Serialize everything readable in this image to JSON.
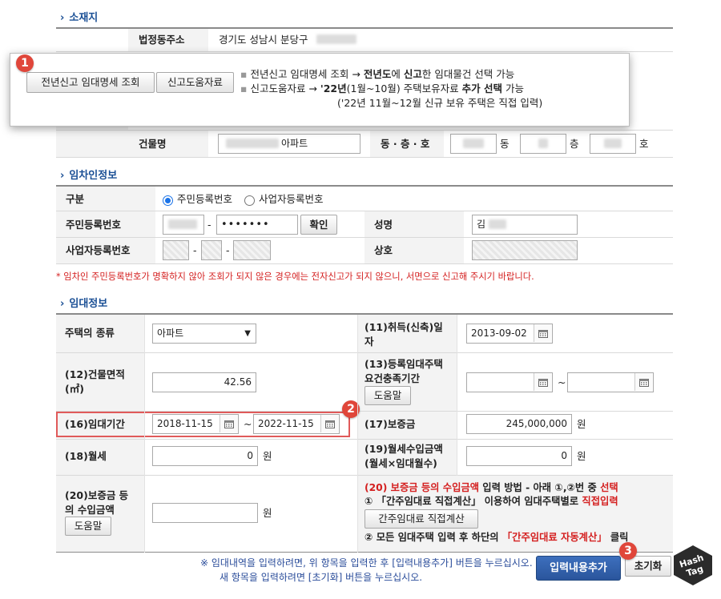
{
  "location": {
    "section_title": "소재지",
    "legal_dong_label": "법정동주소",
    "legal_dong_value": "경기도 성남시 분당구",
    "building_name_label": "건물명",
    "building_name_value": "아파트",
    "dong_cheung_ho_label": "동 · 층 · 호",
    "dong_unit": "동",
    "cheung_unit": "층",
    "ho_unit": "호"
  },
  "popup": {
    "btn_prev_lookup": "전년신고 임대명세 조회",
    "btn_help_data": "신고도움자료",
    "line1_a": "전년신고 임대명세 조회 → ",
    "line1_b": "전년도",
    "line1_c": "에 ",
    "line1_d": "신고",
    "line1_e": "한 임대물건 선택 가능",
    "line2_a": "신고도움자료 → ",
    "line2_b": "'22년",
    "line2_c": "(1월~10월) 주택보유자료 ",
    "line2_d": "추가 선택",
    "line2_e": " 가능",
    "line3": "('22년 11월~12월 신규 보유 주택은 직접 입력)"
  },
  "tenant": {
    "section_title": "임차인정보",
    "type_label": "구분",
    "radio_resident": "주민등록번호",
    "radio_business": "사업자등록번호",
    "resident_no_label": "주민등록번호",
    "resident_no_masked": "•••••••",
    "confirm_button": "확인",
    "name_label": "성명",
    "name_value": "김",
    "business_no_label": "사업자등록번호",
    "trade_name_label": "상호",
    "notice": "* 임차인 주민등록번호가 명확하지 않아 조회가 되지 않은 경우에는 전자신고가 되지 않으니, 서면으로 신고해 주시기 바랍니다."
  },
  "lease": {
    "section_title": "임대정보",
    "house_type_label": "주택의 종류",
    "house_type_value": "아파트",
    "acq_date_label_1": "(11)취득(신축)일",
    "acq_date_label_2": "자",
    "acq_date_value": "2013-09-02",
    "area_label_1": "(12)건물면적",
    "area_label_2": "(㎡)",
    "area_value": "42.56",
    "reg_period_label_1": "(13)등록임대주택",
    "reg_period_label_2": "요건충족기간",
    "help_button": "도움말",
    "period_label": "(16)임대기간",
    "period_start": "2018-11-15",
    "period_end": "2022-11-15",
    "tilde": "~",
    "deposit_label": "(17)보증금",
    "deposit_value": "245,000,000",
    "won": "원",
    "monthly_label": "(18)월세",
    "monthly_value": "0",
    "monthly_income_label_1": "(19)월세수입금액",
    "monthly_income_label_2": "(월세×임대월수)",
    "monthly_income_value": "0",
    "deposit_income_label_1": "(20)보증금 등",
    "deposit_income_label_2": "의 수입금액",
    "deposit_income_help": "도움말",
    "method_red_1": "(20) 보증금 등의 수입금액",
    "method_black_1": " 입력 방법 - 아래 ①,②번 중 ",
    "method_red_2": "선택",
    "method_line2_a": "① 「간주임대료 직접계산」 이용하여 임대주택별로 ",
    "method_line2_b": "직접입력",
    "direct_calc_button": "간주임대료 직접계산",
    "method_line3_a": "② 모든 임대주택 입력 후 하단의 ",
    "method_line3_b": "「간주임대료 자동계산」",
    "method_line3_c": " 클릭"
  },
  "footer": {
    "note1": "※ 임대내역을 입력하려면, 위 항목을 입력한 후 [입력내용추가] 버튼을 누르십시오.",
    "note2": "새 항목을 입력하려면 [초기화] 버튼을 누르십시오.",
    "add_button": "입력내용추가",
    "reset_button": "초기화"
  },
  "badges": {
    "b1": "1",
    "b2": "2",
    "b3": "3"
  },
  "watermark": {
    "line1": "Hash",
    "line2": "Tag"
  },
  "colors": {
    "accent_blue": "#1a4f95",
    "red": "#d42020",
    "badge": "#e0463a",
    "primary_button": "#2f5fa8"
  }
}
